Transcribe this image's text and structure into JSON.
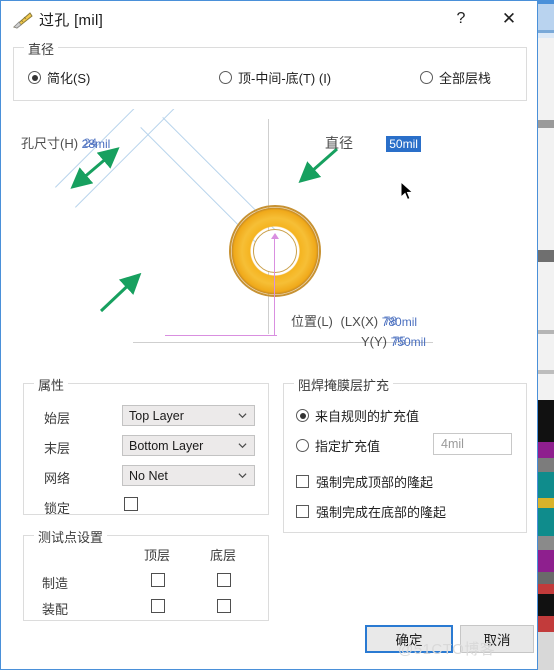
{
  "window": {
    "title": "过孔 [mil]",
    "icon": "ruler-icon",
    "help_label": "?",
    "close_label": "✕",
    "accent_color": "#2a7ad2"
  },
  "diameter_group": {
    "title": "直径",
    "options": [
      {
        "label": "简化(S)",
        "selected": true
      },
      {
        "label": "顶-中间-底(T) (I)",
        "selected": false
      },
      {
        "label": "全部层栈",
        "selected": false
      }
    ]
  },
  "preview": {
    "hole_size_label": "孔尺寸(H)",
    "hole_size_value": "28mil",
    "hole_size_ghost": "24",
    "diameter_label": "直径",
    "diameter_value": "50mil",
    "diameter_selected": true,
    "location_label": "位置(L)",
    "x_label": "(LX(X)",
    "x_value": "780mil",
    "x_ghost": "78",
    "y_label": "Y(Y)",
    "y_value": "750mil",
    "y_ghost": "75",
    "colors": {
      "via_ring": "#f5b420",
      "via_ring_edge": "#c79233",
      "dimension_arrow": "#17a05f",
      "guide_line": "#b8d4ec",
      "axis": "#cfcfcf",
      "center_marker": "#d98fe0"
    }
  },
  "properties_group": {
    "title": "属性",
    "rows": [
      {
        "label": "始层",
        "value": "Top Layer",
        "control": "combobox"
      },
      {
        "label": "末层",
        "value": "Bottom Layer",
        "control": "combobox"
      },
      {
        "label": "网络",
        "value": "No Net",
        "control": "combobox"
      }
    ],
    "lock": {
      "label": "锁定",
      "checked": false
    }
  },
  "solder_mask_group": {
    "title": "阻焊掩膜层扩充",
    "radios": [
      {
        "label": "来自规则的扩充值",
        "selected": true
      },
      {
        "label": "指定扩充值",
        "selected": false
      }
    ],
    "expansion_value": "4mil",
    "expansion_disabled": true,
    "checkboxes": [
      {
        "label": "强制完成顶部的隆起",
        "checked": false
      },
      {
        "label": "强制完成在底部的隆起",
        "checked": false
      }
    ]
  },
  "testpoint_group": {
    "title": "测试点设置",
    "columns": [
      "顶层",
      "底层"
    ],
    "rows": [
      {
        "label": "制造",
        "top": false,
        "bottom": false
      },
      {
        "label": "装配",
        "top": false,
        "bottom": false
      }
    ]
  },
  "footer": {
    "ok_label": "确定",
    "cancel_label": "取消"
  },
  "watermark": {
    "text": "@51CTO博客"
  }
}
